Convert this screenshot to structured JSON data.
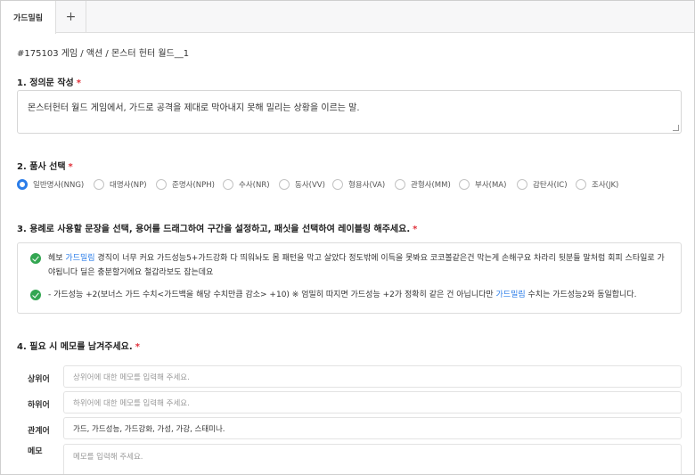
{
  "tabs": [
    {
      "label": "가드밀림"
    },
    {
      "label": "+"
    }
  ],
  "breadcrumb": "#175103 게임 / 액션 / 몬스터 헌터 월드__1",
  "sections": {
    "definition": {
      "title": "1. 정의문 작성",
      "required": "*",
      "value": "몬스터헌터 월드 게임에서, 가드로 공격을 제대로 막아내지 못해 밀리는 상황을 이르는 말."
    },
    "pos": {
      "title": "2. 품사 선택",
      "required": "*",
      "options": [
        {
          "label": "일반명사(NNG)",
          "selected": true
        },
        {
          "label": "대명사(NP)",
          "selected": false
        },
        {
          "label": "준명사(NPH)",
          "selected": false
        },
        {
          "label": "수사(NR)",
          "selected": false
        },
        {
          "label": "동사(VV)",
          "selected": false
        },
        {
          "label": "형용사(VA)",
          "selected": false
        },
        {
          "label": "관형사(MM)",
          "selected": false
        },
        {
          "label": "부사(MA)",
          "selected": false
        },
        {
          "label": "감탄사(IC)",
          "selected": false
        },
        {
          "label": "조사(JK)",
          "selected": false
        }
      ]
    },
    "usage": {
      "title": "3. 용례로 사용할 문장을 선택, 용어를 드래그하여 구간을 설정하고, 패싯을 선택하여 레이블링 해주세요.",
      "required": "*",
      "sentences": [
        {
          "pre": "헤보 ",
          "term": "가드밀림",
          "post": " 경직이 너무 커요 가드성능5+가드강화 다 띄워놔도 몸 패턴을 막고 살았다 정도밖에 이득을 못봐요 코코볼같은건 막는게 손해구요 차라리 뒷분들 말처럼 회피 스타일로 가야됩니다 딜은 충분할거에요 철갑라보도 잡는데요"
        },
        {
          "pre": "- 가드성능 +2(보너스 가드 수치<가드백을 해당 수치만큼 감소> +10) ※ 엄밀히 따지면 가드성능 +2가 정확히 같은 건 아닙니다만 ",
          "term": "가드밀림",
          "post": " 수치는 가드성능2와 동일합니다."
        }
      ]
    },
    "memo": {
      "title": "4. 필요 시 메모를 남겨주세요.",
      "required": "*",
      "hypernym_label": "상위어",
      "hypernym_placeholder": "상위어에 대한 메모를 입력해 주세요.",
      "hyponym_label": "하위어",
      "hyponym_placeholder": "하위어에 대한 메모를 입력해 주세요.",
      "related_label": "관계어",
      "related_value": "가드, 가드성능, 가드강화, 가성, 가강, 스태미나.",
      "note_label": "메모",
      "note_placeholder": "메모를 입력해 주세요."
    }
  },
  "colors": {
    "accent": "#2b7de9",
    "required": "#e0303a",
    "check": "#33a651"
  }
}
